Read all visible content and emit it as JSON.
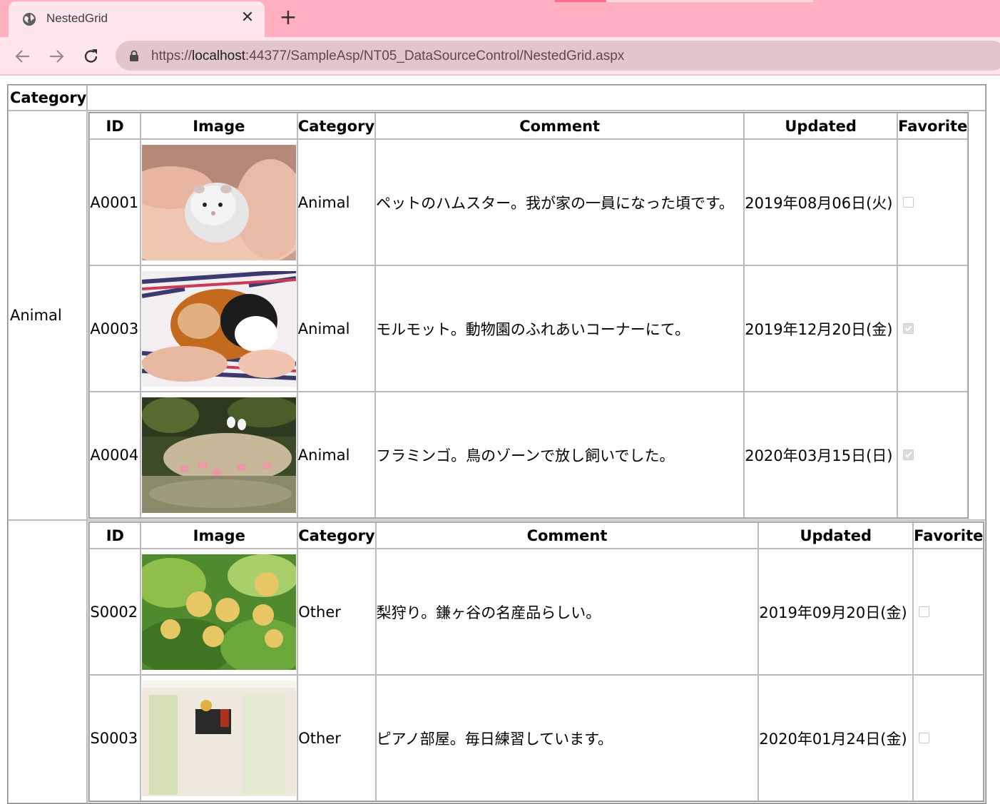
{
  "browser": {
    "tab_title": "NestedGrid",
    "tab_close": "✕",
    "new_tab": "+",
    "url_prefix": "https://",
    "url_host": "localhost",
    "url_rest": ":44377/SampleAsp/NT05_DataSourceControl/NestedGrid.aspx"
  },
  "grid": {
    "outer_header": "Category",
    "columns": [
      "ID",
      "Image",
      "Category",
      "Comment",
      "Updated",
      "Favorite"
    ],
    "groups": [
      {
        "category": "Animal",
        "rows": [
          {
            "id": "A0001",
            "image": "hamster",
            "category": "Animal",
            "comment": "ペットのハムスター。我が家の一員になった頃です。",
            "updated": "2019年08月06日(火)",
            "favorite": false
          },
          {
            "id": "A0003",
            "image": "guinea-pig",
            "category": "Animal",
            "comment": "モルモット。動物園のふれあいコーナーにて。",
            "updated": "2019年12月20日(金)",
            "favorite": true
          },
          {
            "id": "A0004",
            "image": "flamingos",
            "category": "Animal",
            "comment": "フラミンゴ。鳥のゾーンで放し飼いでした。",
            "updated": "2020年03月15日(日)",
            "favorite": true
          }
        ]
      },
      {
        "category": "",
        "rows": [
          {
            "id": "S0002",
            "image": "pears",
            "category": "Other",
            "comment": "梨狩り。鎌ヶ谷の名産品らしい。",
            "updated": "2019年09月20日(金)",
            "favorite": false
          },
          {
            "id": "S0003",
            "image": "piano-room",
            "category": "Other",
            "comment": "ピアノ部屋。毎日練習しています。",
            "updated": "2020年01月24日(金)",
            "favorite": false
          }
        ]
      }
    ]
  }
}
